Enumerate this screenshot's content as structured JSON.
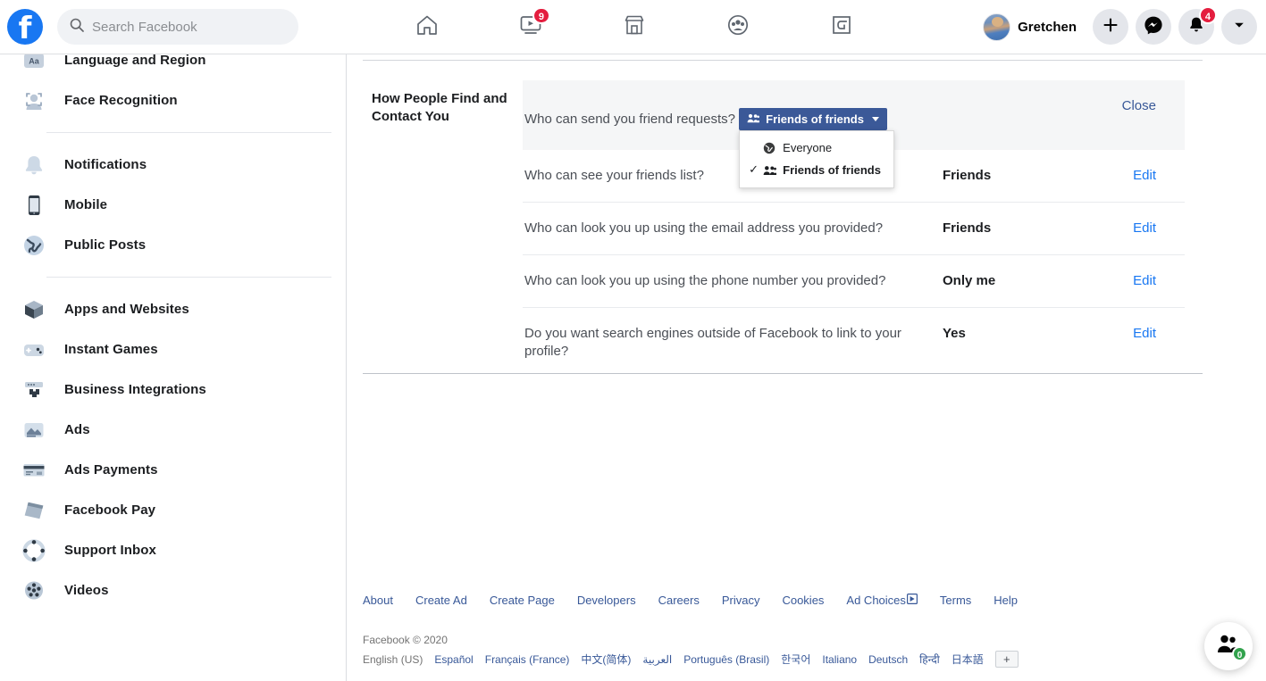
{
  "header": {
    "logo_alt": "Facebook",
    "search": {
      "placeholder": "Search Facebook",
      "value": ""
    },
    "nav": [
      {
        "name": "home",
        "icon": "home-icon",
        "badge": ""
      },
      {
        "name": "watch",
        "icon": "watch-icon",
        "badge": "9"
      },
      {
        "name": "marketplace",
        "icon": "marketplace-icon",
        "badge": ""
      },
      {
        "name": "groups",
        "icon": "groups-icon",
        "badge": ""
      },
      {
        "name": "gaming",
        "icon": "gaming-icon",
        "badge": ""
      }
    ],
    "profile_name": "Gretchen",
    "actions": [
      {
        "name": "create",
        "icon": "plus-icon",
        "badge": ""
      },
      {
        "name": "messenger",
        "icon": "messenger-icon",
        "badge": ""
      },
      {
        "name": "notifications",
        "icon": "bell-icon",
        "badge": "4"
      },
      {
        "name": "account-menu",
        "icon": "chevron-down-icon",
        "badge": ""
      }
    ]
  },
  "sidebar": {
    "items": [
      {
        "label": "Language and Region",
        "icon": "language-icon"
      },
      {
        "label": "Face Recognition",
        "icon": "face-recognition-icon"
      },
      {
        "divider": true
      },
      {
        "label": "Notifications",
        "icon": "bell-icon"
      },
      {
        "label": "Mobile",
        "icon": "mobile-icon"
      },
      {
        "label": "Public Posts",
        "icon": "globe-icon"
      },
      {
        "divider": true
      },
      {
        "label": "Apps and Websites",
        "icon": "cube-icon"
      },
      {
        "label": "Instant Games",
        "icon": "gamepad-icon"
      },
      {
        "label": "Business Integrations",
        "icon": "puzzle-icon"
      },
      {
        "label": "Ads",
        "icon": "ads-icon"
      },
      {
        "label": "Ads Payments",
        "icon": "credit-card-icon"
      },
      {
        "label": "Facebook Pay",
        "icon": "pay-icon"
      },
      {
        "label": "Support Inbox",
        "icon": "lifebuoy-icon"
      },
      {
        "label": "Videos",
        "icon": "film-reel-icon"
      }
    ]
  },
  "main": {
    "section_title": "How People Find and Contact You",
    "rows": [
      {
        "question": "Who can send you friend requests?",
        "value": "",
        "action": "Close",
        "active": true,
        "selector": {
          "current": "Friends of friends",
          "icon": "friends-of-friends-icon",
          "open": true,
          "options": [
            {
              "label": "Everyone",
              "icon": "globe-icon",
              "selected": false
            },
            {
              "label": "Friends of friends",
              "icon": "friends-of-friends-icon",
              "selected": true
            }
          ]
        }
      },
      {
        "question": "Who can see your friends list?",
        "value": "Friends",
        "action": "Edit",
        "active": false
      },
      {
        "question": "Who can look you up using the email address you provided?",
        "value": "Friends",
        "action": "Edit",
        "active": false
      },
      {
        "question": "Who can look you up using the phone number you provided?",
        "value": "Only me",
        "action": "Edit",
        "active": false
      },
      {
        "question": "Do you want search engines outside of Facebook to link to your profile?",
        "value": "Yes",
        "action": "Edit",
        "active": false
      }
    ]
  },
  "footer": {
    "links": [
      "About",
      "Create Ad",
      "Create Page",
      "Developers",
      "Careers",
      "Privacy",
      "Cookies",
      "Ad Choices",
      "Terms",
      "Help"
    ],
    "copyright": "Facebook © 2020",
    "current_language": "English (US)",
    "languages": [
      "Español",
      "Français (France)",
      "中文(简体)",
      "العربية",
      "Português (Brasil)",
      "한국어",
      "Italiano",
      "Deutsch",
      "हिन्दी",
      "日本語"
    ],
    "more_languages": "+"
  },
  "contacts_fab": {
    "icon": "contacts-icon",
    "badge": "0"
  },
  "colors": {
    "brand_blue": "#1877f2",
    "selector_blue": "#3b5998",
    "link_blue": "#385898",
    "badge_red": "#e41e3f",
    "badge_green": "#31a24c",
    "active_row_bg": "#f5f6f7"
  }
}
